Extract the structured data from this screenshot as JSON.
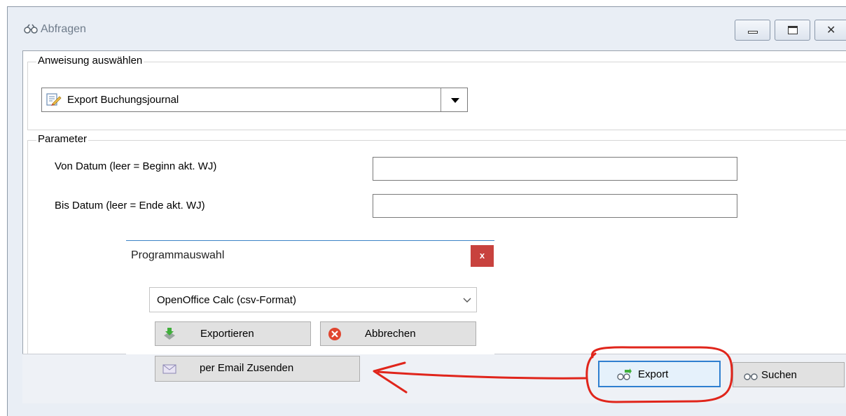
{
  "window": {
    "title": "Abfragen"
  },
  "statement": {
    "legend": "Anweisung auswählen",
    "selected": "Export Buchungsjournal"
  },
  "parameters": {
    "legend": "Parameter",
    "from_label": "Von Datum (leer = Beginn akt. WJ)",
    "from_value": "",
    "to_label": "Bis Datum (leer = Ende akt. WJ)",
    "to_value": ""
  },
  "dialog": {
    "title": "Programmauswahl",
    "close_label": "x",
    "program_selected": "OpenOffice Calc (csv-Format)",
    "export_label": "Exportieren",
    "cancel_label": "Abbrechen",
    "email_label": "per Email Zusenden"
  },
  "actions": {
    "export_label": "Export",
    "search_label": "Suchen"
  },
  "colors": {
    "annotation": "#e0251b",
    "dialog_accent": "#3d84c7",
    "close_button": "#c8423e"
  }
}
